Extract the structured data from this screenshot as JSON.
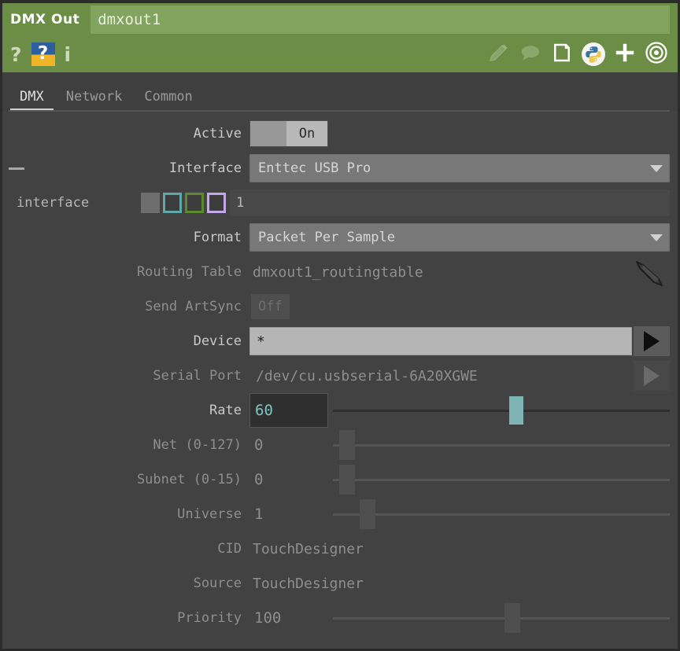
{
  "window": {
    "op_type": "DMX Out",
    "op_name": "dmxout1"
  },
  "header_icons": {
    "help_question": "?",
    "help_badge": "?",
    "info": "i",
    "left_names": [
      "help-icon",
      "help-badge-icon",
      "info-icon"
    ],
    "right_names": [
      "pencil-icon",
      "comment-icon",
      "note-icon",
      "python-icon",
      "plus-icon",
      "target-icon"
    ]
  },
  "tabs": [
    {
      "label": "DMX",
      "active": true
    },
    {
      "label": "Network",
      "active": false
    },
    {
      "label": "Common",
      "active": false
    }
  ],
  "params": {
    "active": {
      "label": "Active",
      "off_label": "",
      "on_label": "On"
    },
    "interface": {
      "label": "Interface",
      "value": "Enttec USB Pro"
    },
    "interface_sub": {
      "label": "interface",
      "value": "1"
    },
    "format": {
      "label": "Format",
      "value": "Packet Per Sample"
    },
    "routing_table": {
      "label": "Routing Table",
      "value": "dmxout1_routingtable"
    },
    "send_artsync": {
      "label": "Send ArtSync",
      "value": "Off"
    },
    "device": {
      "label": "Device",
      "value": "*"
    },
    "serial_port": {
      "label": "Serial Port",
      "value": "/dev/cu.usbserial-6A20XGWE"
    },
    "rate": {
      "label": "Rate",
      "value": "60"
    },
    "net": {
      "label": "Net (0-127)",
      "value": "0"
    },
    "subnet": {
      "label": "Subnet (0-15)",
      "value": "0"
    },
    "universe": {
      "label": "Universe",
      "value": "1"
    },
    "cid": {
      "label": "CID",
      "value": "TouchDesigner"
    },
    "source": {
      "label": "Source",
      "value": "TouchDesigner"
    },
    "priority": {
      "label": "Priority",
      "value": "100"
    }
  },
  "colors": {
    "header_green": "#6b8d46",
    "header_field_green": "#81a45f",
    "panel_bg": "#424242",
    "accent_teal": "#7fb4b4",
    "swatch_teal": "#5fa8a8",
    "swatch_green": "#5a8c2e",
    "swatch_purple": "#c4a8e8"
  }
}
